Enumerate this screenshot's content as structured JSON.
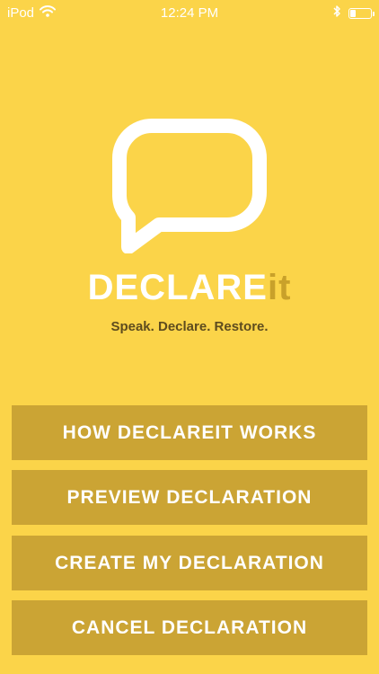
{
  "status_bar": {
    "carrier": "iPod",
    "time": "12:24 PM",
    "icons": [
      "wifi-icon",
      "bluetooth-icon",
      "battery-icon"
    ],
    "battery_level": 0.3
  },
  "brand": {
    "main": "DECLARE",
    "suffix": "it",
    "tagline": "Speak. Declare. Restore.",
    "logo_icon": "speech-bubble-icon"
  },
  "colors": {
    "background": "#FBD449",
    "button": "#CBA434",
    "button_text": "#FFFFFF",
    "accent": "#C9A12A",
    "tagline": "#5E4C1E"
  },
  "buttons": [
    {
      "label": "HOW DECLAREIT WORKS"
    },
    {
      "label": "PREVIEW DECLARATION"
    },
    {
      "label": "CREATE MY DECLARATION"
    },
    {
      "label": "CANCEL DECLARATION"
    }
  ]
}
